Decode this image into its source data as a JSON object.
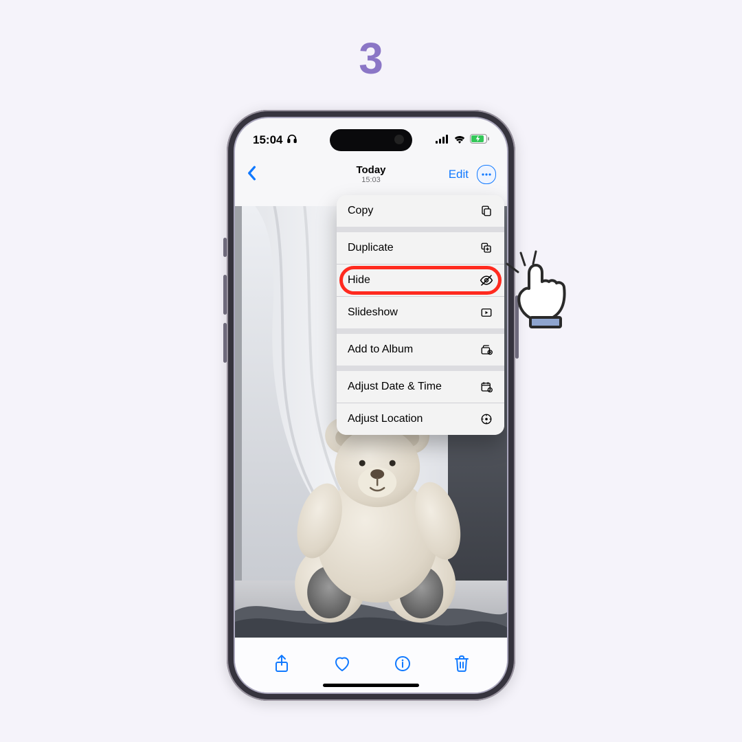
{
  "step_number": "3",
  "status_bar": {
    "time": "15:04"
  },
  "nav": {
    "title": "Today",
    "subtitle": "15:03",
    "edit_label": "Edit"
  },
  "menu": {
    "copy": {
      "label": "Copy",
      "icon": "copy-icon"
    },
    "duplicate": {
      "label": "Duplicate",
      "icon": "duplicate-icon"
    },
    "hide": {
      "label": "Hide",
      "icon": "hide-icon"
    },
    "slideshow": {
      "label": "Slideshow",
      "icon": "slideshow-icon"
    },
    "add_to_album": {
      "label": "Add to Album",
      "icon": "album-icon"
    },
    "adjust_datetime": {
      "label": "Adjust Date & Time",
      "icon": "calendar-icon"
    },
    "adjust_location": {
      "label": "Adjust Location",
      "icon": "location-icon"
    }
  },
  "highlighted_item": "hide",
  "photo": {
    "subject": "teddy bear sitting by a window with white curtain"
  },
  "colors": {
    "accent": "#1079ff",
    "step_number": "#8b76c6",
    "highlight_ring": "#ff2a1f"
  }
}
